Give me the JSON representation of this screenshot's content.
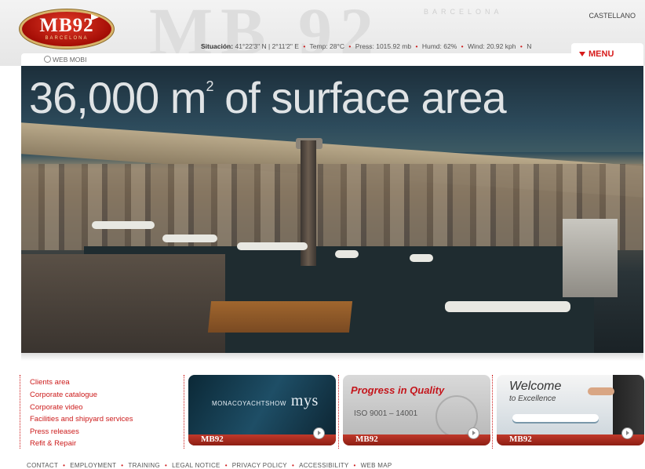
{
  "header": {
    "brand": "MB92",
    "brand_sub": "BARCELONA",
    "watermark": "MB 92",
    "watermark_sub": "BARCELONA",
    "language": "CASTELLANO",
    "web_mobi": "WEB MOBI",
    "menu_label": "MENU"
  },
  "weather": {
    "label": "Situación:",
    "coords": "41°22'3\" N | 2°11'2\" E",
    "temp": "Temp: 28°C",
    "press": "Press: 1015.92 mb",
    "humd": "Humd: 62%",
    "wind": "Wind: 20.92 kph",
    "dir": "N"
  },
  "hero": {
    "title_main": "36,000 m",
    "title_sup": "2",
    "title_rest": " of surface area"
  },
  "quick_links": [
    "Clients area",
    "Corporate catalogue",
    "Corporate video",
    "Facilities and shipyard services",
    "Press releases",
    "Refit & Repair"
  ],
  "banners": {
    "monaco": {
      "label": "MONACOYACHTSHOW",
      "logo": "mys",
      "footer": "MB92"
    },
    "quality": {
      "title": "Progress in Quality",
      "iso": "ISO 9001 – 14001",
      "footer": "MB92"
    },
    "welcome": {
      "title": "Welcome",
      "subtitle": "to Excellence",
      "footer": "MB92"
    }
  },
  "footer": [
    "CONTACT",
    "EMPLOYMENT",
    "TRAINING",
    "LEGAL NOTICE",
    "PRIVACY POLICY",
    "ACCESSIBILITY",
    "WEB MAP"
  ],
  "colors": {
    "accent": "#cc1b1b",
    "header_bg": "#eeeeee"
  }
}
